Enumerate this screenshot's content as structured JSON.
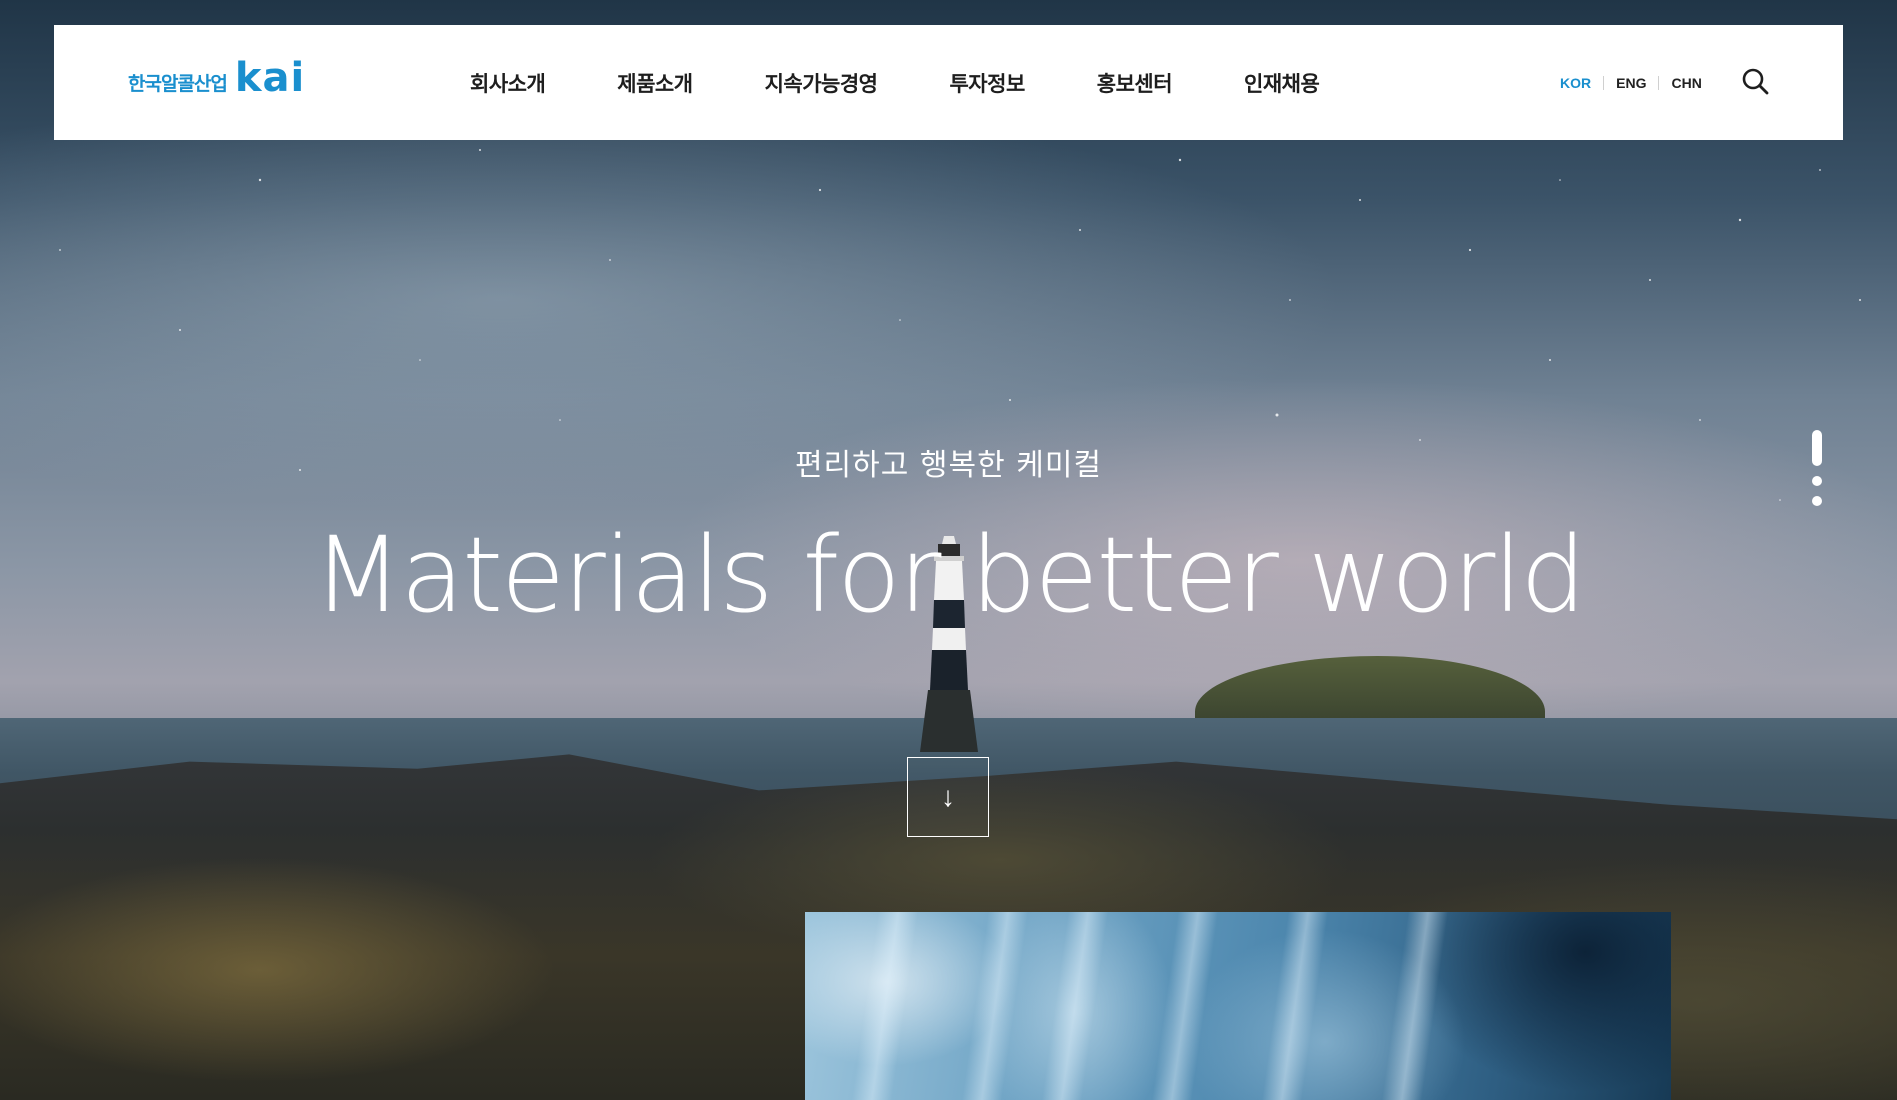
{
  "header": {
    "logo_ko": "한국알콜산업",
    "logo_en": "kai",
    "nav": [
      {
        "label": "회사소개"
      },
      {
        "label": "제품소개"
      },
      {
        "label": "지속가능경영"
      },
      {
        "label": "투자정보"
      },
      {
        "label": "홍보센터"
      },
      {
        "label": "인재채용"
      }
    ],
    "languages": [
      {
        "label": "KOR",
        "active": true
      },
      {
        "label": "ENG",
        "active": false
      },
      {
        "label": "CHN",
        "active": false
      }
    ],
    "search_icon": "search-icon"
  },
  "hero": {
    "subtitle": "편리하고 행복한 케미컬",
    "title": "Materials for better world",
    "scroll_icon": "arrow-down-icon",
    "scroll_symbol": "↓",
    "slide_indicator": {
      "total": 3,
      "active": 1
    }
  },
  "colors": {
    "brand": "#1a8fce",
    "header_bg": "#ffffff",
    "nav_text": "#1e1e1e",
    "hero_text": "#ffffff"
  }
}
